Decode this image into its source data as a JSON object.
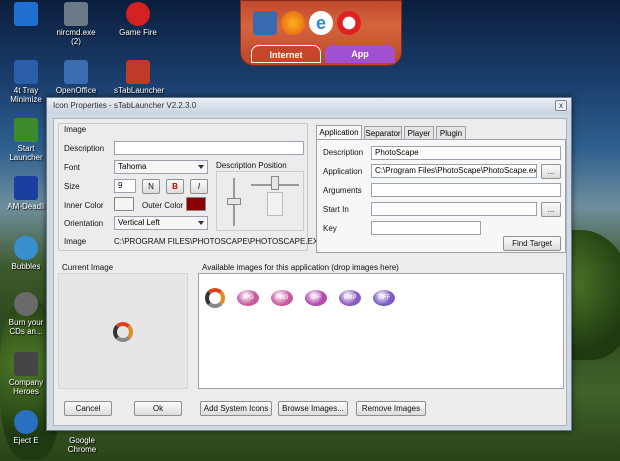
{
  "desktop": {
    "icons": [
      {
        "label": "",
        "color": "#1f6fd1"
      },
      {
        "label": "nircmd.exe (2)",
        "color": "#6c7a88"
      },
      {
        "label": "Game Fire",
        "color": "#d32020"
      },
      {
        "label": "4t Tray Minimize",
        "color": "#2b5ea8"
      },
      {
        "label": "OpenOffice",
        "color": "#3a6cb0"
      },
      {
        "label": "sTabLauncher",
        "color": "#c03a2a"
      },
      {
        "label": "Start Launcher",
        "color": "#3b8a2e"
      },
      {
        "label": "AM-Deadli",
        "color": "#1a3fa0"
      },
      {
        "label": "Bubbles",
        "color": "#3a8fd0"
      },
      {
        "label": "Burn your CDs an...",
        "color": "#6a6a6a"
      },
      {
        "label": "Company Heroes",
        "color": "#444444"
      },
      {
        "label": "Eject E",
        "color": "#2a70c0"
      },
      {
        "label": "Google Chrome",
        "color": ""
      }
    ]
  },
  "stab": {
    "tabs": [
      "Internet",
      "App"
    ],
    "icons": [
      "monitor-icon",
      "firefox-icon",
      "ie-icon",
      "opera-icon"
    ]
  },
  "window": {
    "title": "Icon Properties - sTabLauncher V2.2.3.0",
    "close_glyph": "x",
    "image_group": {
      "title": "Image",
      "description_label": "Description",
      "description_value": "",
      "font_label": "Font",
      "font_value": "Tahoma",
      "size_label": "Size",
      "size_value": "9",
      "style_buttons": [
        "N",
        "B",
        "I"
      ],
      "inner_color_label": "Inner Color",
      "inner_color": "#f4f4f4",
      "outer_color_label": "Outer Color",
      "outer_color": "#8b0000",
      "orientation_label": "Orientation",
      "orientation_value": "Vertical Left",
      "image_label": "Image",
      "image_value": "C:\\PROGRAM FILES\\PHOTOSCAPE\\PHOTOSCAPE.EXE",
      "desc_position_label": "Description Position"
    },
    "tabs": [
      "Application",
      "Separator",
      "Player",
      "Plugin"
    ],
    "app": {
      "description_label": "Description",
      "description_value": "PhotoScape",
      "application_label": "Application",
      "application_value": "C:\\Program Files\\PhotoScape\\PhotoScape.exe",
      "arguments_label": "Arguments",
      "arguments_value": "",
      "startin_label": "Start In",
      "startin_value": "",
      "key_label": "Key",
      "key_value": "",
      "browse_label": "...",
      "find_target_label": "Find Target"
    },
    "current_image_label": "Current Image",
    "available_label": "Available images for this application  (drop images here)",
    "available_images": [
      {
        "icon": "photoscape-icon",
        "label": ""
      },
      {
        "icon": "jpg-icon",
        "label": "JPG",
        "color": "#c85aa0"
      },
      {
        "icon": "png-icon",
        "label": "PNG",
        "color": "#c85aa0"
      },
      {
        "icon": "gif-icon",
        "label": "GIF",
        "color": "#b04ab0"
      },
      {
        "icon": "bmp-icon",
        "label": "BMP",
        "color": "#8a5ac0"
      },
      {
        "icon": "tiff-icon",
        "label": "TIFF",
        "color": "#7a5ac8"
      }
    ],
    "buttons": {
      "cancel": "Cancel",
      "ok": "Ok",
      "add_system_icons": "Add System Icons",
      "browse_images": "Browse Images...",
      "remove_images": "Remove Images"
    }
  }
}
